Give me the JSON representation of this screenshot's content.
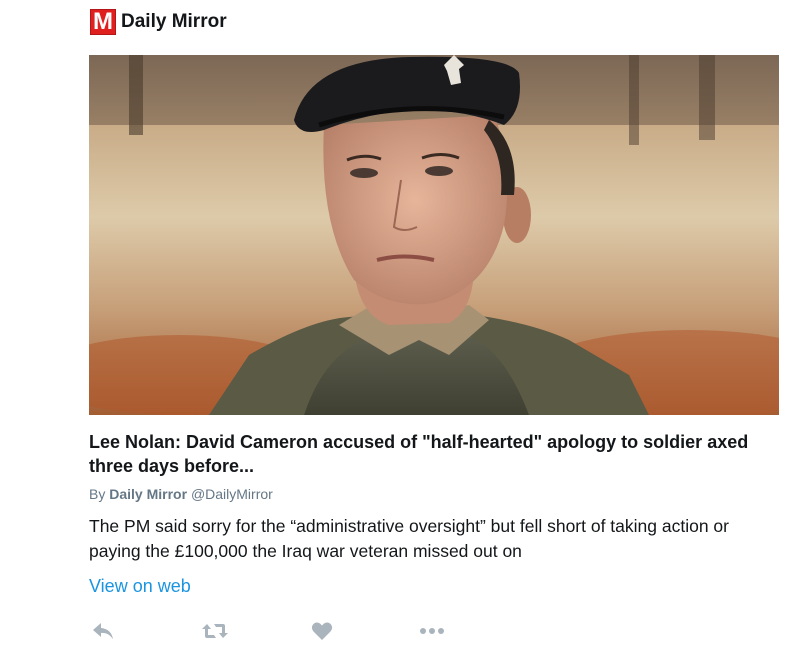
{
  "source": {
    "logo_letter": "M",
    "name": "Daily Mirror",
    "brand_color": "#e0201f"
  },
  "card": {
    "image_alt": "Portrait of a soldier in a black beret and olive uniform",
    "title": "Lee Nolan: David Cameron accused of \"half-hearted\" apology to soldier axed three days before...",
    "byline": {
      "prefix": "By",
      "author": "Daily Mirror",
      "handle": "@DailyMirror"
    },
    "description": "The PM said sorry for the “administrative oversight” but fell short of taking action or paying the £100,000 the Iraq war veteran missed out on",
    "link_label": "View on web",
    "link_color": "#1b95e0"
  },
  "actions": [
    {
      "name": "reply",
      "icon": "reply-icon"
    },
    {
      "name": "retweet",
      "icon": "retweet-icon"
    },
    {
      "name": "like",
      "icon": "heart-icon"
    },
    {
      "name": "more",
      "icon": "more-icon"
    }
  ]
}
